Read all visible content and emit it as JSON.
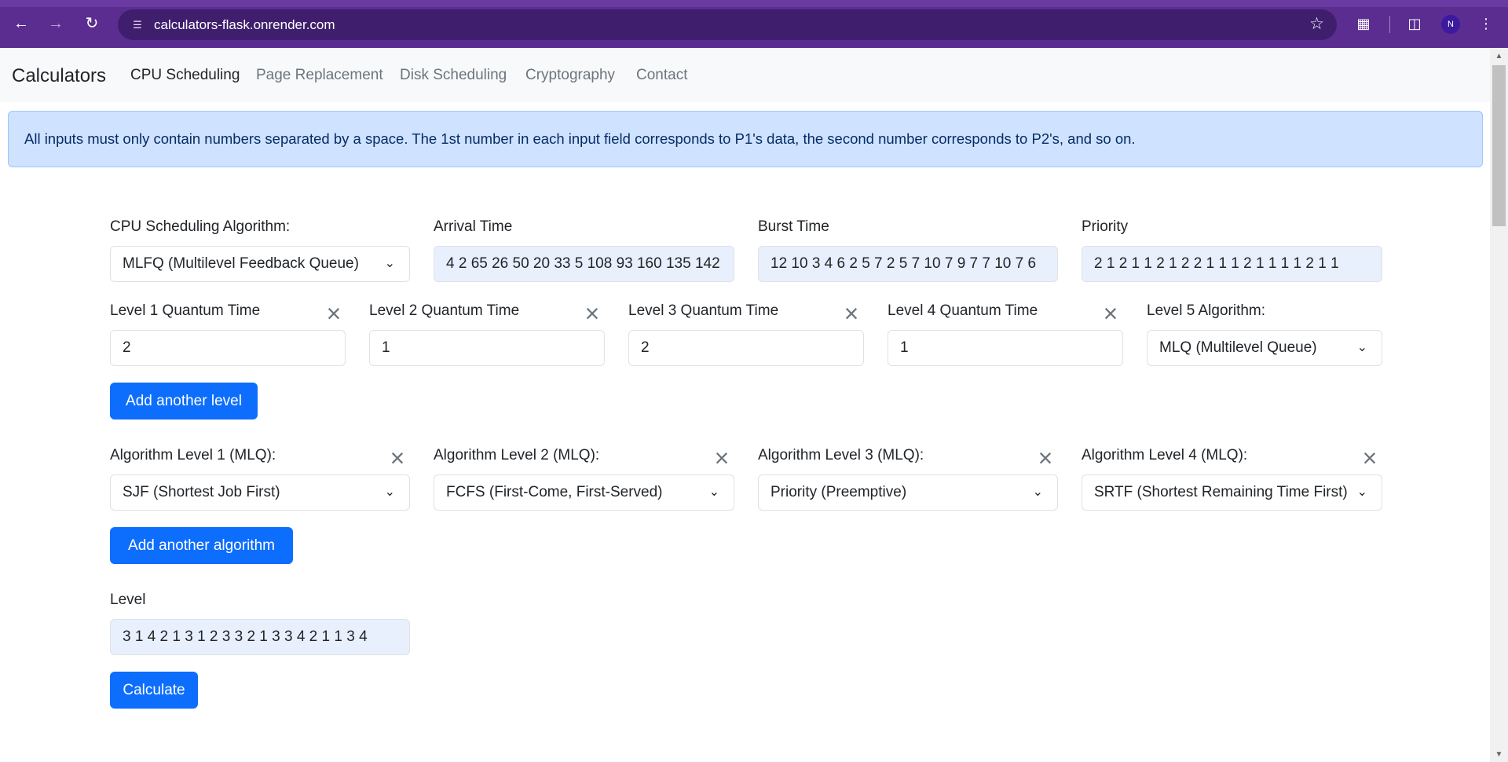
{
  "browser": {
    "url": "calculators-flask.onrender.com",
    "profile_initial": "N"
  },
  "navbar": {
    "brand": "Calculators",
    "links": [
      "CPU Scheduling",
      "Page Replacement",
      "Disk Scheduling",
      "Cryptography",
      "Contact"
    ]
  },
  "alert": {
    "text": "All inputs must only contain numbers separated by a space. The 1st number in each input field corresponds to P1's data, the second number corresponds to P2's, and so on."
  },
  "form": {
    "algorithm_label": "CPU Scheduling Algorithm:",
    "algorithm_value": "MLFQ (Multilevel Feedback Queue)",
    "arrival_label": "Arrival Time",
    "arrival_value": "4 2 65 26 50 20 33 5 108 93 160 135 142",
    "burst_label": "Burst Time",
    "burst_value": "12 10 3 4 6 2 5 7 2 5 7 10 7 9 7 7 10 7 6",
    "priority_label": "Priority",
    "priority_value": "2 1 2 1 1 2 1 2 2 1 1 1 2 1 1 1 1 2 1 1",
    "quantum_levels": [
      {
        "label": "Level 1 Quantum Time",
        "value": "2"
      },
      {
        "label": "Level 2 Quantum Time",
        "value": "1"
      },
      {
        "label": "Level 3 Quantum Time",
        "value": "2"
      },
      {
        "label": "Level 4 Quantum Time",
        "value": "1"
      }
    ],
    "level5_label": "Level 5 Algorithm:",
    "level5_value": "MLQ (Multilevel Queue)",
    "add_level_button": "Add another level",
    "mlq_algorithms": [
      {
        "label": "Algorithm Level 1 (MLQ):",
        "value": "SJF (Shortest Job First)"
      },
      {
        "label": "Algorithm Level 2 (MLQ):",
        "value": "FCFS (First-Come, First-Served)"
      },
      {
        "label": "Algorithm Level 3 (MLQ):",
        "value": "Priority (Preemptive)"
      },
      {
        "label": "Algorithm Level 4 (MLQ):",
        "value": "SRTF (Shortest Remaining Time First)"
      }
    ],
    "add_algorithm_button": "Add another algorithm",
    "level_label": "Level",
    "level_value": "3 1 4 2 1 3 1 2 3 3 2 1 3 3 4 2 1 1 3 4",
    "calculate_button": "Calculate"
  },
  "icons": {
    "back": "arrow-left-icon",
    "forward": "arrow-right-icon",
    "reload": "reload-icon",
    "site_info": "tune-icon",
    "bookmark": "star-icon",
    "extensions": "puzzle-icon",
    "sidepanel": "sidepanel-icon",
    "menu": "kebab-menu-icon",
    "remove": "close-icon",
    "dropdown": "chevron-down-icon"
  }
}
